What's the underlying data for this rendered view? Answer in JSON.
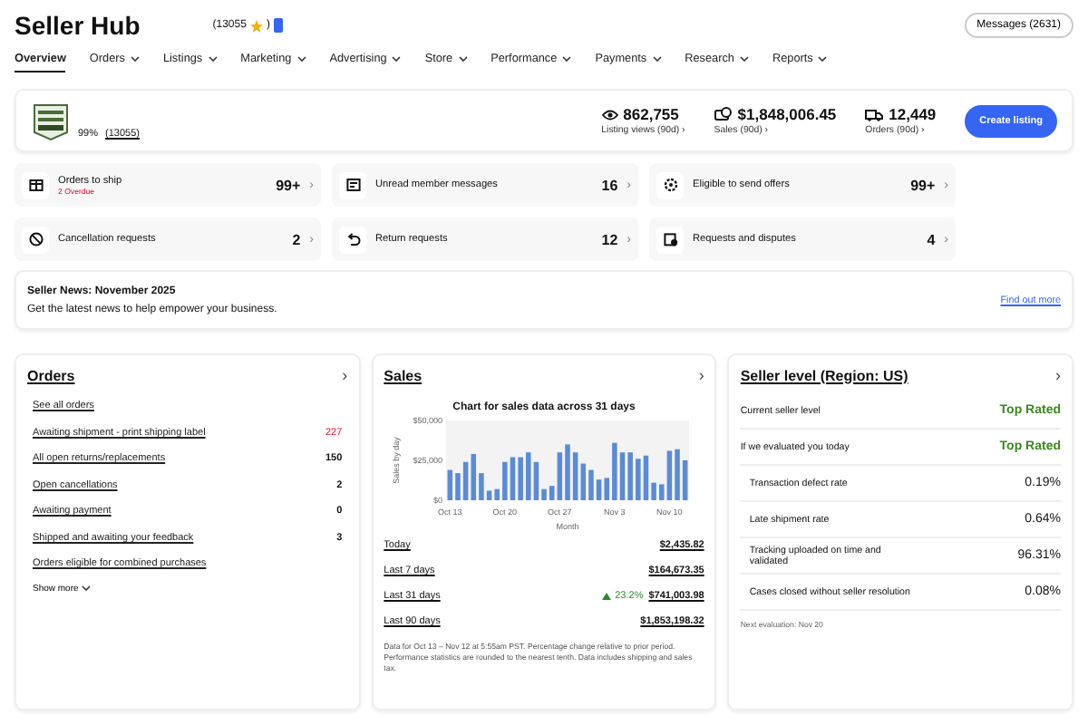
{
  "header": {
    "title": "Seller Hub",
    "feedback_open": "(13055",
    "feedback_close": ")",
    "messages": "Messages (2631)"
  },
  "nav": [
    {
      "label": "Overview",
      "selected": true,
      "menu": false
    },
    {
      "label": "Orders",
      "selected": false,
      "menu": true
    },
    {
      "label": "Listings",
      "selected": false,
      "menu": true
    },
    {
      "label": "Marketing",
      "selected": false,
      "menu": true
    },
    {
      "label": "Advertising",
      "selected": false,
      "menu": true
    },
    {
      "label": "Store",
      "selected": false,
      "menu": true
    },
    {
      "label": "Performance",
      "selected": false,
      "menu": true
    },
    {
      "label": "Payments",
      "selected": false,
      "menu": true
    },
    {
      "label": "Research",
      "selected": false,
      "menu": true
    },
    {
      "label": "Reports",
      "selected": false,
      "menu": true
    }
  ],
  "store": {
    "rating": "99%",
    "feedback": "(13055)",
    "stats": [
      {
        "kind": "views",
        "value": "862,755",
        "label": "Listing views (90d) ›"
      },
      {
        "kind": "sales",
        "value": "$1,848,006.45",
        "label": "Sales (90d) ›"
      },
      {
        "kind": "orders",
        "value": "12,449",
        "label": "Orders (90d) ›"
      }
    ],
    "button": "Create listing"
  },
  "tasks": [
    {
      "kind": "box",
      "label": "Orders to ship",
      "sub": "2 Overdue",
      "count": "99+",
      "chevron": "›"
    },
    {
      "kind": "message",
      "label": "Unread member messages",
      "count": "16",
      "chevron": "›"
    },
    {
      "kind": "offer",
      "label": "Eligible to send offers",
      "count": "99+",
      "chevron": "›"
    },
    {
      "kind": "cancel",
      "label": "Cancellation requests",
      "count": "2",
      "chevron": "›"
    },
    {
      "kind": "return",
      "label": "Return requests",
      "count": "12",
      "chevron": "›"
    },
    {
      "kind": "dispute",
      "label": "Requests and disputes",
      "count": "4",
      "chevron": "›"
    }
  ],
  "news": {
    "title": "Seller News: November 2025",
    "text": "Get the latest news to help empower your business.",
    "link": "Find out more"
  },
  "orders": {
    "title": "Orders",
    "chevron": "›",
    "items": [
      {
        "label": "See all orders"
      },
      {
        "label": "Awaiting shipment - print shipping label",
        "count": "227",
        "alert": true
      },
      {
        "label": "All open returns/replacements",
        "count": "150",
        "alert": false
      },
      {
        "label": "Open cancellations",
        "count": "2",
        "alert": false
      },
      {
        "label": "Awaiting payment",
        "count": "0",
        "alert": false
      },
      {
        "label": "Shipped and awaiting your feedback",
        "count": "3",
        "alert": false
      },
      {
        "label": "Orders eligible for combined purchases"
      }
    ],
    "show_more": "Show more"
  },
  "sales": {
    "title": "Sales",
    "chevron": "›",
    "chart_data": {
      "type": "bar",
      "title": "Chart for sales data across 31 days",
      "xlabel": "Month",
      "ylabel": "Sales by day",
      "categories": [
        "Oct 13",
        null,
        null,
        null,
        null,
        null,
        null,
        "Oct 20",
        null,
        null,
        null,
        null,
        null,
        null,
        "Oct 27",
        null,
        null,
        null,
        null,
        null,
        null,
        "Nov 3",
        null,
        null,
        null,
        null,
        null,
        null,
        "Nov 10",
        null,
        null
      ],
      "series": [
        {
          "color": "#5b8bd6",
          "values": [
            19000,
            17000,
            24000,
            29000,
            17000,
            6000,
            7000,
            24000,
            27000,
            27000,
            30000,
            24000,
            7000,
            9000,
            30000,
            35000,
            30000,
            23000,
            19000,
            13000,
            14000,
            36000,
            30000,
            30000,
            26000,
            28000,
            11000,
            10000,
            31000,
            32000,
            25000
          ]
        }
      ],
      "ylim": [
        0,
        50000
      ],
      "yticks": [
        {
          "value": 0,
          "label": "$0"
        },
        {
          "value": 25000,
          "label": "$25,000"
        },
        {
          "value": 50000,
          "label": "$50,000"
        }
      ]
    },
    "rows": [
      {
        "label": "Today",
        "value": "$2,435.82"
      },
      {
        "label": "Last 7 days",
        "value": "$164,673.35"
      },
      {
        "label": "Last 31 days",
        "change": "23.2%",
        "value": "$741,003.98"
      },
      {
        "label": "Last 90 days",
        "value": "$1,853,198.32"
      }
    ],
    "note": "Data for Oct 13 – Nov 12 at 5:55am PST. Percentage change relative to prior period. Performance statistics are rounded to the nearest tenth. Data includes shipping and sales tax."
  },
  "seller_level": {
    "title": "Seller level (Region: US)",
    "chevron": "›",
    "rows": [
      {
        "kind": "level",
        "label": "Current seller level",
        "value": "Top Rated"
      },
      {
        "kind": "level",
        "label": "If we evaluated you today",
        "value": "Top Rated"
      },
      {
        "kind": "metric",
        "label": "Transaction defect rate",
        "value": "0.19%"
      },
      {
        "kind": "metric",
        "label": "Late shipment rate",
        "value": "0.64%"
      },
      {
        "kind": "metric",
        "label": "Tracking uploaded on time and validated",
        "value": "96.31%"
      },
      {
        "kind": "metric",
        "label": "Cases closed without seller resolution",
        "value": "0.08%"
      }
    ],
    "next": "Next evaluation: Nov 20"
  }
}
